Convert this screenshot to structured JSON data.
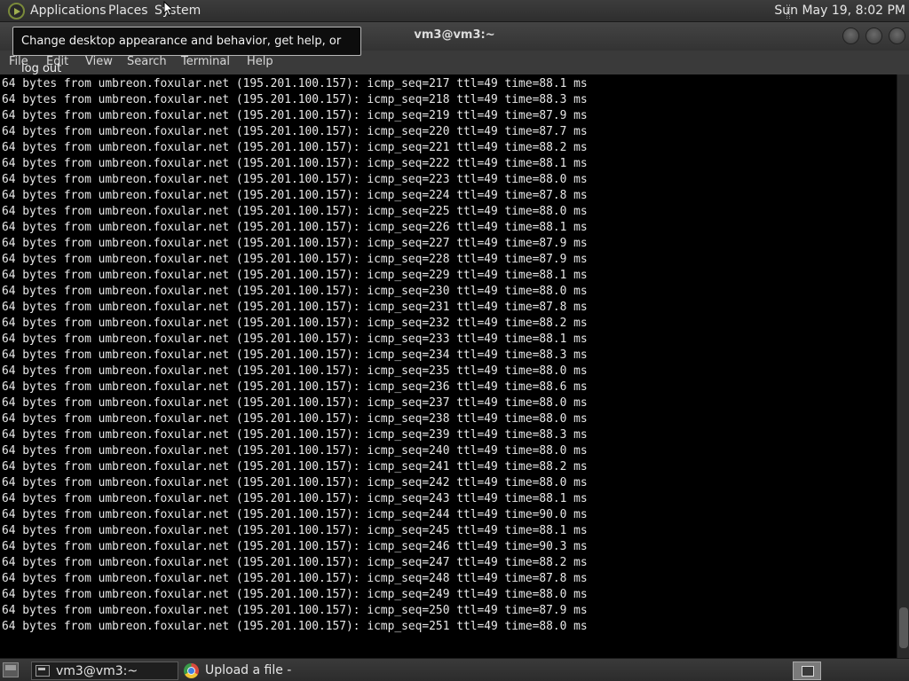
{
  "top_panel": {
    "applications": "Applications",
    "places": "Places",
    "system": "System",
    "clock": "Sun May 19,  8:02 PM"
  },
  "tooltip": "Change desktop appearance and behavior, get help, or log out",
  "window": {
    "title": "vm3@vm3:~",
    "menu": [
      "File",
      "Edit",
      "View",
      "Search",
      "Terminal",
      "Help"
    ]
  },
  "terminal": {
    "lines": [
      "64 bytes from umbreon.foxular.net (195.201.100.157): icmp_seq=217 ttl=49 time=88.1 ms",
      "64 bytes from umbreon.foxular.net (195.201.100.157): icmp_seq=218 ttl=49 time=88.3 ms",
      "64 bytes from umbreon.foxular.net (195.201.100.157): icmp_seq=219 ttl=49 time=87.9 ms",
      "64 bytes from umbreon.foxular.net (195.201.100.157): icmp_seq=220 ttl=49 time=87.7 ms",
      "64 bytes from umbreon.foxular.net (195.201.100.157): icmp_seq=221 ttl=49 time=88.2 ms",
      "64 bytes from umbreon.foxular.net (195.201.100.157): icmp_seq=222 ttl=49 time=88.1 ms",
      "64 bytes from umbreon.foxular.net (195.201.100.157): icmp_seq=223 ttl=49 time=88.0 ms",
      "64 bytes from umbreon.foxular.net (195.201.100.157): icmp_seq=224 ttl=49 time=87.8 ms",
      "64 bytes from umbreon.foxular.net (195.201.100.157): icmp_seq=225 ttl=49 time=88.0 ms",
      "64 bytes from umbreon.foxular.net (195.201.100.157): icmp_seq=226 ttl=49 time=88.1 ms",
      "64 bytes from umbreon.foxular.net (195.201.100.157): icmp_seq=227 ttl=49 time=87.9 ms",
      "64 bytes from umbreon.foxular.net (195.201.100.157): icmp_seq=228 ttl=49 time=87.9 ms",
      "64 bytes from umbreon.foxular.net (195.201.100.157): icmp_seq=229 ttl=49 time=88.1 ms",
      "64 bytes from umbreon.foxular.net (195.201.100.157): icmp_seq=230 ttl=49 time=88.0 ms",
      "64 bytes from umbreon.foxular.net (195.201.100.157): icmp_seq=231 ttl=49 time=87.8 ms",
      "64 bytes from umbreon.foxular.net (195.201.100.157): icmp_seq=232 ttl=49 time=88.2 ms",
      "64 bytes from umbreon.foxular.net (195.201.100.157): icmp_seq=233 ttl=49 time=88.1 ms",
      "64 bytes from umbreon.foxular.net (195.201.100.157): icmp_seq=234 ttl=49 time=88.3 ms",
      "64 bytes from umbreon.foxular.net (195.201.100.157): icmp_seq=235 ttl=49 time=88.0 ms",
      "64 bytes from umbreon.foxular.net (195.201.100.157): icmp_seq=236 ttl=49 time=88.6 ms",
      "64 bytes from umbreon.foxular.net (195.201.100.157): icmp_seq=237 ttl=49 time=88.0 ms",
      "64 bytes from umbreon.foxular.net (195.201.100.157): icmp_seq=238 ttl=49 time=88.0 ms",
      "64 bytes from umbreon.foxular.net (195.201.100.157): icmp_seq=239 ttl=49 time=88.3 ms",
      "64 bytes from umbreon.foxular.net (195.201.100.157): icmp_seq=240 ttl=49 time=88.0 ms",
      "64 bytes from umbreon.foxular.net (195.201.100.157): icmp_seq=241 ttl=49 time=88.2 ms",
      "64 bytes from umbreon.foxular.net (195.201.100.157): icmp_seq=242 ttl=49 time=88.0 ms",
      "64 bytes from umbreon.foxular.net (195.201.100.157): icmp_seq=243 ttl=49 time=88.1 ms",
      "64 bytes from umbreon.foxular.net (195.201.100.157): icmp_seq=244 ttl=49 time=90.0 ms",
      "64 bytes from umbreon.foxular.net (195.201.100.157): icmp_seq=245 ttl=49 time=88.1 ms",
      "64 bytes from umbreon.foxular.net (195.201.100.157): icmp_seq=246 ttl=49 time=90.3 ms",
      "64 bytes from umbreon.foxular.net (195.201.100.157): icmp_seq=247 ttl=49 time=88.2 ms",
      "64 bytes from umbreon.foxular.net (195.201.100.157): icmp_seq=248 ttl=49 time=87.8 ms",
      "64 bytes from umbreon.foxular.net (195.201.100.157): icmp_seq=249 ttl=49 time=88.0 ms",
      "64 bytes from umbreon.foxular.net (195.201.100.157): icmp_seq=250 ttl=49 time=87.9 ms",
      "64 bytes from umbreon.foxular.net (195.201.100.157): icmp_seq=251 ttl=49 time=88.0 ms"
    ]
  },
  "taskbar": {
    "tasks": [
      {
        "label": "vm3@vm3:~",
        "icon": "terminal-icon"
      },
      {
        "label": "Upload a file - Chro...",
        "icon": "chrome-icon"
      }
    ]
  },
  "icons": {
    "applications": "applications-logo-icon",
    "show_desktop": "show-desktop-icon",
    "workspace": "workspace-switcher-icon"
  }
}
